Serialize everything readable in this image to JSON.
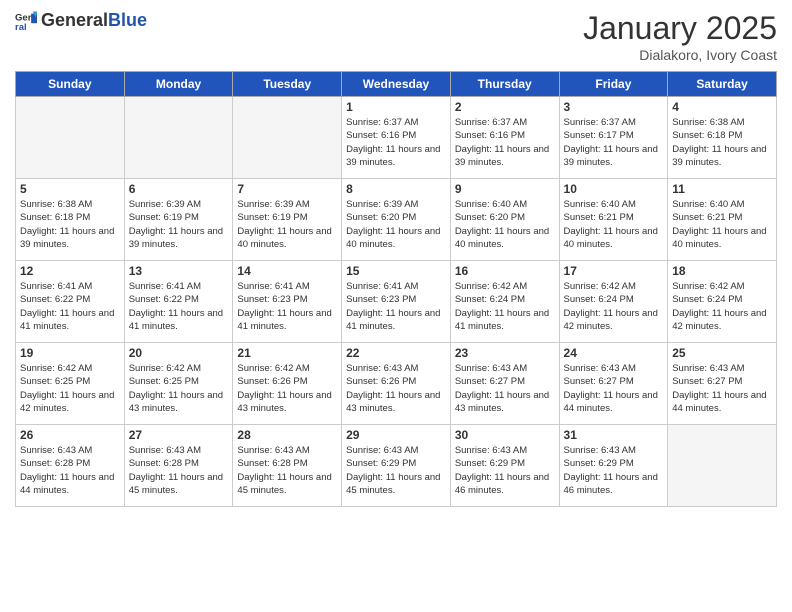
{
  "header": {
    "logo_general": "General",
    "logo_blue": "Blue",
    "title": "January 2025",
    "subtitle": "Dialakoro, Ivory Coast"
  },
  "days_of_week": [
    "Sunday",
    "Monday",
    "Tuesday",
    "Wednesday",
    "Thursday",
    "Friday",
    "Saturday"
  ],
  "weeks": [
    [
      {
        "day": "",
        "info": ""
      },
      {
        "day": "",
        "info": ""
      },
      {
        "day": "",
        "info": ""
      },
      {
        "day": "1",
        "info": "Sunrise: 6:37 AM\nSunset: 6:16 PM\nDaylight: 11 hours and 39 minutes."
      },
      {
        "day": "2",
        "info": "Sunrise: 6:37 AM\nSunset: 6:16 PM\nDaylight: 11 hours and 39 minutes."
      },
      {
        "day": "3",
        "info": "Sunrise: 6:37 AM\nSunset: 6:17 PM\nDaylight: 11 hours and 39 minutes."
      },
      {
        "day": "4",
        "info": "Sunrise: 6:38 AM\nSunset: 6:18 PM\nDaylight: 11 hours and 39 minutes."
      }
    ],
    [
      {
        "day": "5",
        "info": "Sunrise: 6:38 AM\nSunset: 6:18 PM\nDaylight: 11 hours and 39 minutes."
      },
      {
        "day": "6",
        "info": "Sunrise: 6:39 AM\nSunset: 6:19 PM\nDaylight: 11 hours and 39 minutes."
      },
      {
        "day": "7",
        "info": "Sunrise: 6:39 AM\nSunset: 6:19 PM\nDaylight: 11 hours and 40 minutes."
      },
      {
        "day": "8",
        "info": "Sunrise: 6:39 AM\nSunset: 6:20 PM\nDaylight: 11 hours and 40 minutes."
      },
      {
        "day": "9",
        "info": "Sunrise: 6:40 AM\nSunset: 6:20 PM\nDaylight: 11 hours and 40 minutes."
      },
      {
        "day": "10",
        "info": "Sunrise: 6:40 AM\nSunset: 6:21 PM\nDaylight: 11 hours and 40 minutes."
      },
      {
        "day": "11",
        "info": "Sunrise: 6:40 AM\nSunset: 6:21 PM\nDaylight: 11 hours and 40 minutes."
      }
    ],
    [
      {
        "day": "12",
        "info": "Sunrise: 6:41 AM\nSunset: 6:22 PM\nDaylight: 11 hours and 41 minutes."
      },
      {
        "day": "13",
        "info": "Sunrise: 6:41 AM\nSunset: 6:22 PM\nDaylight: 11 hours and 41 minutes."
      },
      {
        "day": "14",
        "info": "Sunrise: 6:41 AM\nSunset: 6:23 PM\nDaylight: 11 hours and 41 minutes."
      },
      {
        "day": "15",
        "info": "Sunrise: 6:41 AM\nSunset: 6:23 PM\nDaylight: 11 hours and 41 minutes."
      },
      {
        "day": "16",
        "info": "Sunrise: 6:42 AM\nSunset: 6:24 PM\nDaylight: 11 hours and 41 minutes."
      },
      {
        "day": "17",
        "info": "Sunrise: 6:42 AM\nSunset: 6:24 PM\nDaylight: 11 hours and 42 minutes."
      },
      {
        "day": "18",
        "info": "Sunrise: 6:42 AM\nSunset: 6:24 PM\nDaylight: 11 hours and 42 minutes."
      }
    ],
    [
      {
        "day": "19",
        "info": "Sunrise: 6:42 AM\nSunset: 6:25 PM\nDaylight: 11 hours and 42 minutes."
      },
      {
        "day": "20",
        "info": "Sunrise: 6:42 AM\nSunset: 6:25 PM\nDaylight: 11 hours and 43 minutes."
      },
      {
        "day": "21",
        "info": "Sunrise: 6:42 AM\nSunset: 6:26 PM\nDaylight: 11 hours and 43 minutes."
      },
      {
        "day": "22",
        "info": "Sunrise: 6:43 AM\nSunset: 6:26 PM\nDaylight: 11 hours and 43 minutes."
      },
      {
        "day": "23",
        "info": "Sunrise: 6:43 AM\nSunset: 6:27 PM\nDaylight: 11 hours and 43 minutes."
      },
      {
        "day": "24",
        "info": "Sunrise: 6:43 AM\nSunset: 6:27 PM\nDaylight: 11 hours and 44 minutes."
      },
      {
        "day": "25",
        "info": "Sunrise: 6:43 AM\nSunset: 6:27 PM\nDaylight: 11 hours and 44 minutes."
      }
    ],
    [
      {
        "day": "26",
        "info": "Sunrise: 6:43 AM\nSunset: 6:28 PM\nDaylight: 11 hours and 44 minutes."
      },
      {
        "day": "27",
        "info": "Sunrise: 6:43 AM\nSunset: 6:28 PM\nDaylight: 11 hours and 45 minutes."
      },
      {
        "day": "28",
        "info": "Sunrise: 6:43 AM\nSunset: 6:28 PM\nDaylight: 11 hours and 45 minutes."
      },
      {
        "day": "29",
        "info": "Sunrise: 6:43 AM\nSunset: 6:29 PM\nDaylight: 11 hours and 45 minutes."
      },
      {
        "day": "30",
        "info": "Sunrise: 6:43 AM\nSunset: 6:29 PM\nDaylight: 11 hours and 46 minutes."
      },
      {
        "day": "31",
        "info": "Sunrise: 6:43 AM\nSunset: 6:29 PM\nDaylight: 11 hours and 46 minutes."
      },
      {
        "day": "",
        "info": ""
      }
    ]
  ]
}
